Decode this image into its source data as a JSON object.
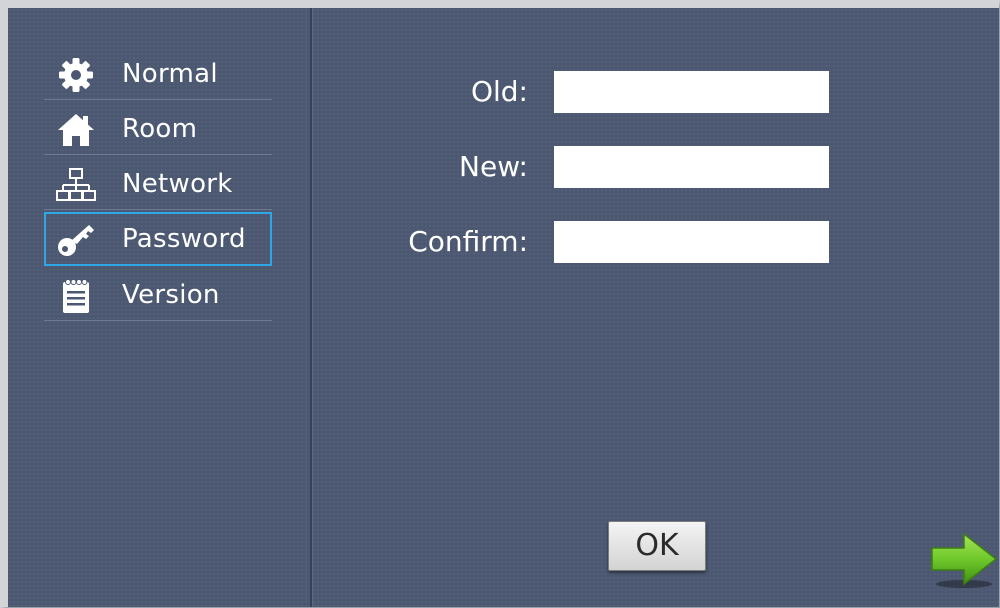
{
  "sidebar": {
    "items": [
      {
        "label": "Normal",
        "icon": "gear-icon"
      },
      {
        "label": "Room",
        "icon": "home-icon"
      },
      {
        "label": "Network",
        "icon": "network-icon"
      },
      {
        "label": "Password",
        "icon": "key-icon",
        "selected": true
      },
      {
        "label": "Version",
        "icon": "notepad-icon"
      }
    ]
  },
  "form": {
    "old_label": "Old:",
    "old_value": "",
    "new_label": "New:",
    "new_value": "",
    "confirm_label": "Confirm:",
    "confirm_value": ""
  },
  "buttons": {
    "ok_label": "OK",
    "next_icon": "green-arrow-right-icon"
  },
  "colors": {
    "background": "#4c5872",
    "selection_border": "#2fa7e6",
    "arrow_green": "#6fc92a"
  }
}
